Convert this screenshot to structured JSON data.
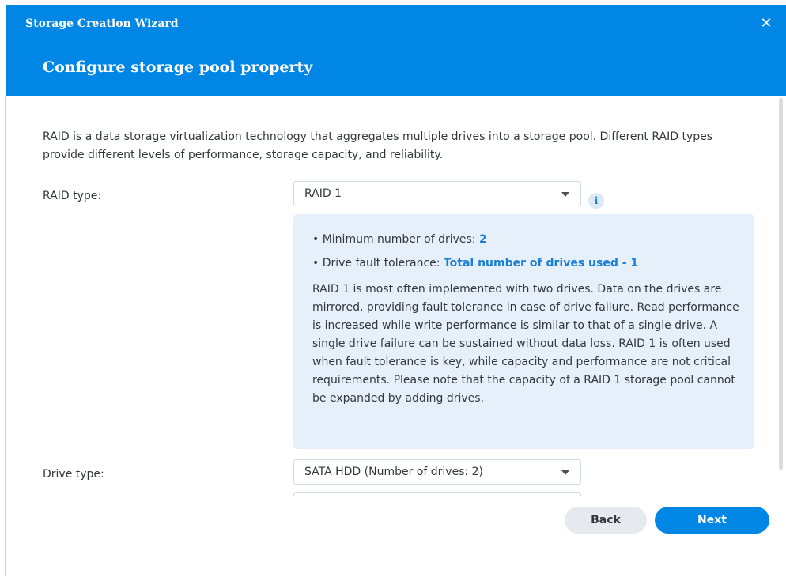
{
  "window": {
    "title": "Storage Creation Wizard",
    "close_icon": "close-icon",
    "close_glyph": "✕"
  },
  "header": {
    "page_title": "Configure storage pool property"
  },
  "intro_text": "RAID is a data storage virtualization technology that aggregates multiple drives into a storage pool. Different RAID types provide different levels of performance, storage capacity, and reliability.",
  "raid_type": {
    "label": "RAID type:",
    "selected": "RAID 1",
    "info_icon": "info-icon",
    "info_glyph": "i"
  },
  "raid_info": {
    "min_drives_label": "• Minimum number of drives:",
    "min_drives_value": "2",
    "fault_tolerance_label": "• Drive fault tolerance:",
    "fault_tolerance_value": "Total number of drives used - 1",
    "description": "RAID 1 is most often implemented with two drives. Data on the drives are mirrored, providing fault tolerance in case of drive failure. Read performance is increased while write performance is similar to that of a single drive. A single drive failure can be sustained without data loss. RAID 1 is often used when fault tolerance is key, while capacity and performance are not critical requirements. Please note that the capacity of a RAID 1 storage pool cannot be expanded by adding drives."
  },
  "drive_type": {
    "label": "Drive type:",
    "selected": "SATA HDD (Number of drives:  2)"
  },
  "footer": {
    "back_label": "Back",
    "next_label": "Next"
  },
  "colors": {
    "accent": "#0086e5",
    "info_panel": "#e6f0fa",
    "highlight_text": "#1b7fd6"
  }
}
